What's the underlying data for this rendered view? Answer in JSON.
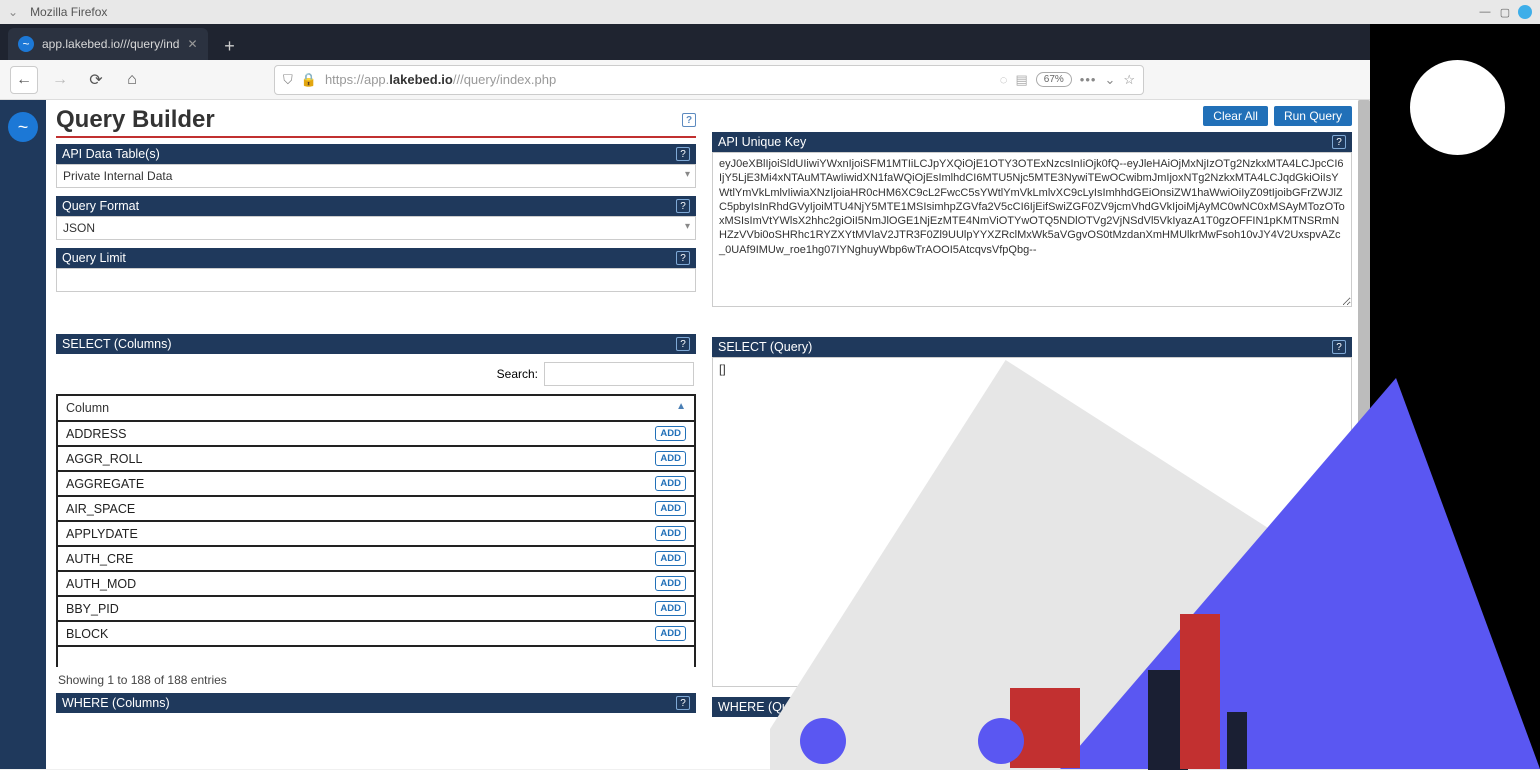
{
  "browser": {
    "window_title": "Mozilla Firefox",
    "tab_title": "app.lakebed.io///query/ind",
    "url_prefix": "https://app.",
    "url_domain": "lakebed.io",
    "url_path": "///query/index.php",
    "zoom": "67%"
  },
  "header": {
    "title": "Query Builder",
    "clear_btn": "Clear All",
    "run_btn": "Run Query"
  },
  "panels": {
    "api_data_tables": "API Data Table(s)",
    "query_format": "Query Format",
    "query_limit": "Query Limit",
    "select_columns": "SELECT (Columns)",
    "where_columns": "WHERE (Columns)",
    "api_unique_key": "API Unique Key",
    "select_query": "SELECT (Query)",
    "where_query": "WHERE (Quer"
  },
  "fields": {
    "data_table_value": "Private Internal Data",
    "query_format_value": "JSON",
    "query_limit_value": "",
    "search_label": "Search:",
    "search_value": ""
  },
  "api_key": "eyJ0eXBlIjoiSldUIiwiYWxnIjoiSFM1MTIiLCJpYXQiOjE1OTY3OTExNzcsInIiOjk0fQ--eyJleHAiOjMxNjIzOTg2NzkxMTA4LCJpcCI6IjY5LjE3Mi4xNTAuMTAwIiwidXN1faWQiOjEsImlhdCI6MTU5Njc5MTE3NywiTEwOCwibmJmIjoxNTg2NzkxMTA4LCJqdGkiOiIsYWtlYmVkLmlvIiwiaXNzIjoiaHR0cHM6XC9cL2FwcC5sYWtlYmVkLmlvXC9cLyIsImhhdGEiOnsiZW1haWwiOiIyZ09tIjoibGFrZWJlZC5pbyIsInRhdGVyIjoiMTU4NjY5MTE1MSIsimhpZGVfa2V5cCI6IjEifSwiZGF0ZV9jcmVhdGVkIjoiMjAyMC0wNC0xMSAyMTozOToxMSIsImVtYWlsX2hhc2giOiI5NmJlOGE1NjEzMTE4NmViOTYwOTQ5NDlOTVg2VjNSdVl5VkIyazA1T0gzOFFIN1pKMTNSRmNHZzVVbi0oSHRhc1RYZXYtMVlaV2JTR3F0Zl9UUlpYYXZRclMxWk5aVGgvOS0tMzdanXmHMUlkrMwFsoh10vJY4V2UxspvAZc_0UAf9IMUw_roe1hg07IYNghuyWbp6wTrAOOI5AtcqvsVfpQbg--",
  "select_query_value": "[]",
  "columns": {
    "header": "Column",
    "add_label": "ADD",
    "items": [
      "ADDRESS",
      "AGGR_ROLL",
      "AGGREGATE",
      "AIR_SPACE",
      "APPLYDATE",
      "AUTH_CRE",
      "AUTH_MOD",
      "BBY_PID",
      "BLOCK"
    ],
    "footer_showing": "Showing 1 to 188 of 188 entries"
  }
}
